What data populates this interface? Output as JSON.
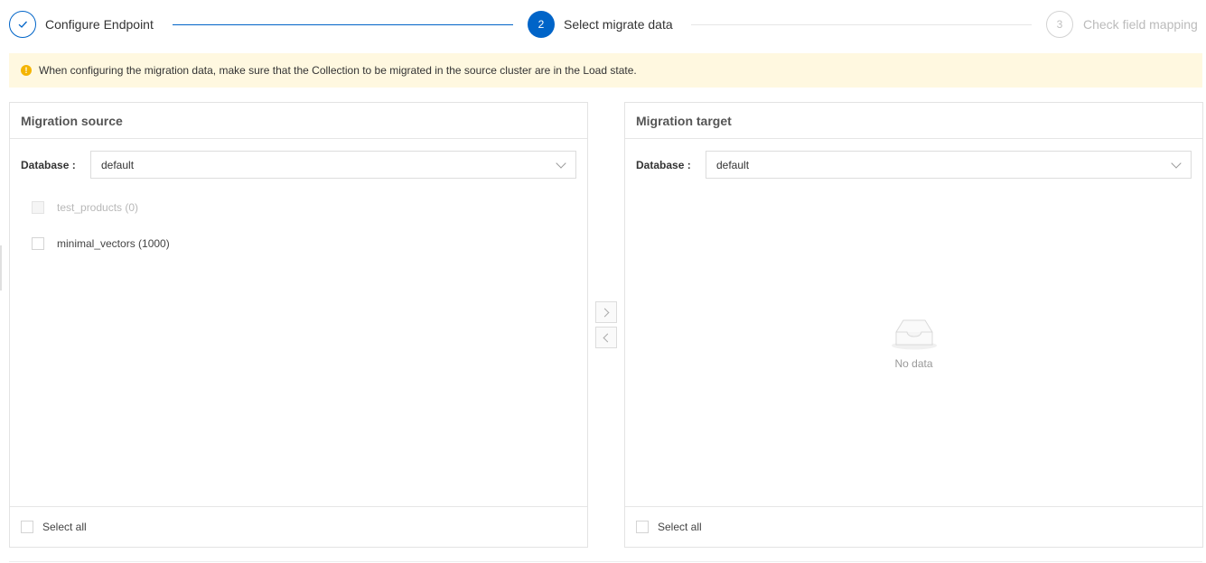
{
  "steps": [
    {
      "number": "1",
      "label": "Configure Endpoint",
      "status": "done",
      "icon": "check-icon"
    },
    {
      "number": "2",
      "label": "Select migrate data",
      "status": "active"
    },
    {
      "number": "3",
      "label": "Check field mapping",
      "status": "pending"
    }
  ],
  "notice": {
    "icon": "warning-icon",
    "text": "When configuring the migration data, make sure that the Collection to be migrated in the source cluster are in the Load state."
  },
  "source": {
    "title": "Migration source",
    "database_label": "Database :",
    "database_value": "default",
    "items": [
      {
        "label": "test_products (0)",
        "disabled": true,
        "checked": false
      },
      {
        "label": "minimal_vectors (1000)",
        "disabled": false,
        "checked": false
      }
    ],
    "select_all_label": "Select all"
  },
  "target": {
    "title": "Migration target",
    "database_label": "Database :",
    "database_value": "default",
    "empty_text": "No data",
    "select_all_label": "Select all"
  },
  "colors": {
    "primary": "#0064c8",
    "notice_bg": "#fff8e0",
    "warning": "#f4b400"
  }
}
